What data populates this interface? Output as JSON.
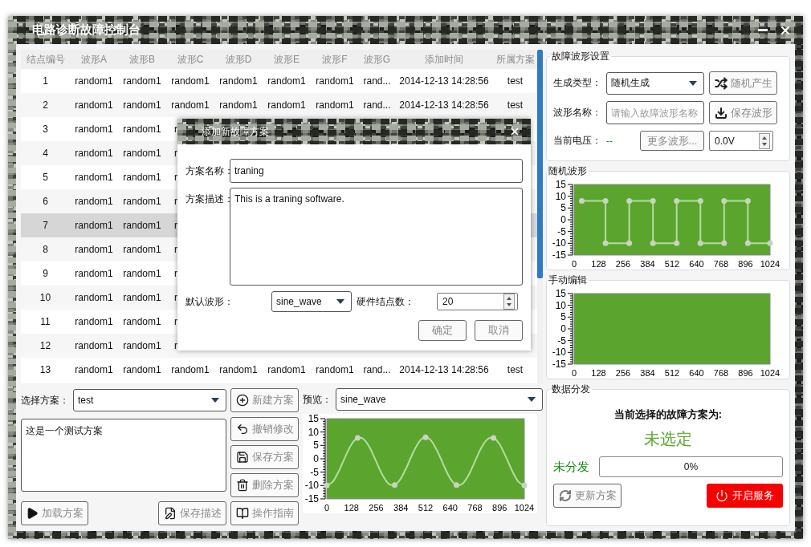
{
  "window": {
    "title": "电路诊断故障控制台"
  },
  "table": {
    "columns": [
      "结点编号",
      "波形A",
      "波形B",
      "波形C",
      "波形D",
      "波形E",
      "波形F",
      "波形G",
      "添加时间",
      "所属方案"
    ],
    "rows": [
      {
        "cells": [
          "1",
          "random1",
          "random1",
          "random1",
          "random1",
          "random1",
          "random1",
          "rand...",
          "2014-12-13 14:28:56",
          "test"
        ],
        "selected": false
      },
      {
        "cells": [
          "2",
          "random1",
          "random1",
          "random1",
          "random1",
          "random1",
          "random1",
          "rand...",
          "2014-12-13 14:28:56",
          "test"
        ],
        "selected": false
      },
      {
        "cells": [
          "3",
          "random1",
          "random1",
          "r"
        ],
        "selected": false
      },
      {
        "cells": [
          "4",
          "random1",
          "random1",
          "r"
        ],
        "selected": false
      },
      {
        "cells": [
          "5",
          "random1",
          "random1",
          "r"
        ],
        "selected": false
      },
      {
        "cells": [
          "6",
          "random1",
          "random1",
          "r"
        ],
        "selected": false
      },
      {
        "cells": [
          "7",
          "random1",
          "random1",
          "r"
        ],
        "selected": true
      },
      {
        "cells": [
          "8",
          "random1",
          "random1",
          "r"
        ],
        "selected": false
      },
      {
        "cells": [
          "9",
          "random1",
          "random1",
          "r"
        ],
        "selected": false
      },
      {
        "cells": [
          "10",
          "random1",
          "random1",
          "r"
        ],
        "selected": false
      },
      {
        "cells": [
          "11",
          "random1",
          "random1",
          "r"
        ],
        "selected": false
      },
      {
        "cells": [
          "12",
          "random1",
          "random1",
          "r"
        ],
        "selected": false
      },
      {
        "cells": [
          "13",
          "random1",
          "random1",
          "random1",
          "random1",
          "random1",
          "random1",
          "rand...",
          "2014-12-13 14:28:56",
          "test"
        ],
        "selected": false
      }
    ]
  },
  "dialog": {
    "title": "添加新故障方案",
    "name_label": "方案名称：",
    "name_value": "traning",
    "desc_label": "方案描述：",
    "desc_value": "This is a traning software.",
    "wave_label": "默认波形：",
    "wave_value": "sine_wave",
    "nodes_label": "硬件结点数：",
    "nodes_value": "20",
    "buttons": [
      "确定",
      "取消"
    ]
  },
  "scheme": {
    "label": "选择方案：",
    "value": "test",
    "description": "这是一个测试方案",
    "new_button": "新建方案",
    "side_buttons": [
      "撤销修改",
      "保存方案",
      "删除方案",
      "操作指南"
    ],
    "load_button": "加载方案",
    "save_desc_button": "保存描述"
  },
  "preview": {
    "label": "预览：",
    "value": "sine_wave",
    "chart_data": {
      "type": "line",
      "xlim": [
        0,
        1024
      ],
      "ylim": [
        -15,
        15
      ],
      "xticks": [
        0,
        128,
        256,
        384,
        512,
        640,
        768,
        896,
        1024
      ],
      "yticks": [
        -15,
        -10,
        -5,
        0,
        5,
        10,
        15
      ],
      "x": [
        0,
        32,
        64,
        96,
        128,
        160,
        192,
        224,
        256,
        288,
        320,
        352,
        384,
        416,
        448,
        480,
        512,
        544,
        576,
        608,
        640,
        672,
        704,
        736,
        768,
        800,
        832,
        864,
        896,
        928,
        960,
        992,
        1024
      ],
      "series": [
        {
          "color": "#b5dca0",
          "marker": true,
          "values": [
            -10,
            -8.5,
            -4.4,
            0.8,
            5.4,
            7.8,
            7.3,
            4,
            -1,
            -6,
            -9.3,
            -9.8,
            -7.4,
            -2.8,
            2.4,
            6.5,
            8,
            6.5,
            2.4,
            -2.8,
            -7.4,
            -9.8,
            -9.3,
            -6,
            -1,
            4,
            7.3,
            7.8,
            5.4,
            0.8,
            -4.4,
            -8.5,
            -10
          ]
        }
      ]
    }
  },
  "waveform_settings": {
    "title": "故障波形设置",
    "type_label": "生成类型：",
    "type_value": "随机生成",
    "random_button": "随机产生",
    "name_label": "波形名称：",
    "name_placeholder": "请输入故障波形名称",
    "save_button": "保存波形",
    "voltage_label": "当前电压：",
    "voltage_value": "--",
    "more_button": "更多波形...",
    "voltage_spin": "0.0V"
  },
  "random_wave": {
    "title": "随机波形",
    "chart_data": {
      "type": "line",
      "xlim": [
        0,
        1024
      ],
      "ylim": [
        -15,
        15
      ],
      "xticks": [
        0,
        128,
        256,
        384,
        512,
        640,
        768,
        896,
        1024
      ],
      "yticks": [
        -15,
        -10,
        -5,
        0,
        5,
        10,
        15
      ],
      "x": [
        40,
        164,
        164,
        288,
        288,
        412,
        412,
        536,
        536,
        660,
        660,
        784,
        784,
        908,
        908,
        1024
      ],
      "series": [
        {
          "color": "#b5dca0",
          "marker": true,
          "values": [
            8,
            8,
            -10,
            -10,
            8,
            8,
            -10,
            -10,
            8,
            8,
            -10,
            -10,
            8,
            8,
            -10,
            -10
          ]
        }
      ]
    }
  },
  "manual_edit": {
    "title": "手动编辑",
    "chart_data": {
      "type": "line",
      "xlim": [
        0,
        1024
      ],
      "ylim": [
        -15,
        15
      ],
      "xticks": [
        0,
        128,
        256,
        384,
        512,
        640,
        768,
        896,
        1024
      ],
      "yticks": [
        -15,
        -10,
        -5,
        0,
        5,
        10,
        15
      ]
    }
  },
  "distribution": {
    "title": "数据分发",
    "heading": "当前选择的故障方案为:",
    "scheme_name": "未选定",
    "status": "未分发",
    "progress": {
      "level": 0,
      "label": "0%"
    },
    "refresh_button": "更新方案",
    "service_button": "开启服务"
  }
}
